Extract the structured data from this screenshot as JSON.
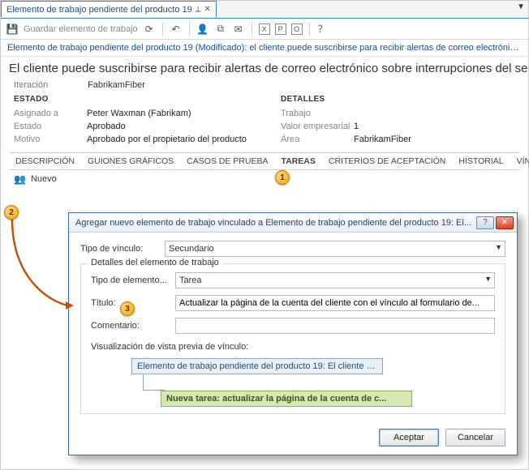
{
  "window": {
    "tab_title": "Elemento de trabajo pendiente del producto 19"
  },
  "toolbar": {
    "save_label": "Guardar elemento de trabajo"
  },
  "infobar": "Elemento de trabajo pendiente del producto 19 (Modificado): el cliente puede suscribirse para recibir alertas de correo electrónico...",
  "heading": "El cliente puede suscribirse para recibir alertas de correo electrónico sobre interrupciones del servicio",
  "iteration": {
    "label": "Iteración",
    "value": "FabrikamFiber"
  },
  "state": {
    "header": "ESTADO",
    "assigned_label": "Asignado a",
    "assigned_value": "Peter Waxman (Fabrikam)",
    "state_label": "Estado",
    "state_value": "Aprobado",
    "reason_label": "Motivo",
    "reason_value": "Aprobado por el propietario del producto"
  },
  "details": {
    "header": "DETALLES",
    "effort_label": "Trabajo",
    "effort_value": "",
    "bv_label": "Valor empresarial",
    "bv_value": "1",
    "area_label": "Área",
    "area_value": "FabrikamFiber"
  },
  "tabs": {
    "desc": "DESCRIPCIÓN",
    "story": "GUIONES GRÁFICOS",
    "test": "CASOS DE PRUEBA",
    "tasks": "TAREAS",
    "accept": "CRITERIOS DE ACEPTACIÓN",
    "hist": "HISTORIAL",
    "links": "VÍNC..."
  },
  "subbar": {
    "new_label": "Nuevo"
  },
  "badges": {
    "b1": "1",
    "b2": "2",
    "b3": "3"
  },
  "dialog": {
    "title": "Agregar nuevo elemento de trabajo vinculado a Elemento de trabajo pendiente del producto 19: El...",
    "linktype_label": "Tipo de vínculo:",
    "linktype_value": "Secundario",
    "group_legend": "Detalles del elemento de trabajo",
    "worktype_label": "Tipo de elemento...",
    "worktype_value": "Tarea",
    "title_label": "Título:",
    "title_value": "Actualizar la página de la cuenta del cliente con el vínculo al formulario de...",
    "comment_label": "Comentario:",
    "comment_value": "",
    "preview_label": "Visualización de vista previa de vínculo:",
    "parent_node": "Elemento de trabajo pendiente del producto 19: El cliente pu...",
    "child_node": "Nueva tarea: actualizar la página de la cuenta de c...",
    "ok": "Aceptar",
    "cancel": "Cancelar"
  }
}
